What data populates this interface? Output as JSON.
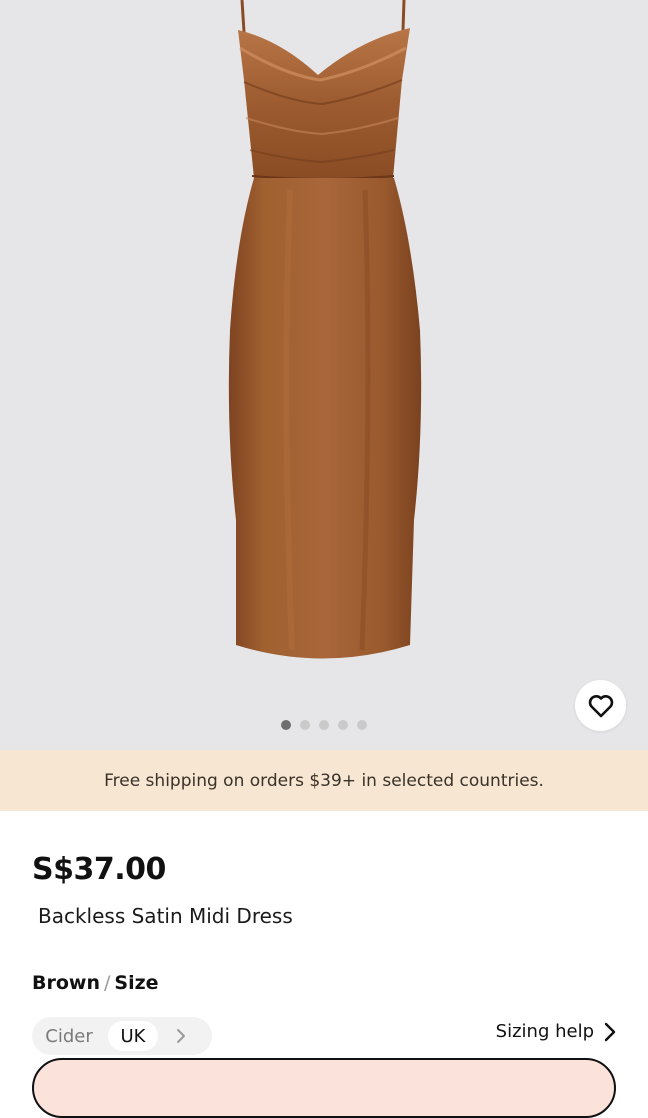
{
  "gallery": {
    "image_alt": "Backless Satin Midi Dress in brown",
    "dots_total": 5,
    "active_dot": 0,
    "favorite_icon": "heart-outline-icon"
  },
  "banner": {
    "text": "Free shipping on orders $39+ in selected countries."
  },
  "product": {
    "price": "S$37.00",
    "title": "Backless Satin Midi Dress",
    "color": "Brown",
    "separator": "/",
    "size_label": "Size"
  },
  "size_system": {
    "options": [
      "Cider",
      "UK"
    ],
    "selected": "UK",
    "more_icon": "chevron-right-icon"
  },
  "sizing_help": {
    "label": "Sizing help",
    "icon": "chevron-right-icon"
  },
  "colors": {
    "gallery_bg": "#e6e6e8",
    "banner_bg": "#f6e6d2",
    "dress": "#9c5a2e",
    "button_bg": "#fbe3dc"
  }
}
